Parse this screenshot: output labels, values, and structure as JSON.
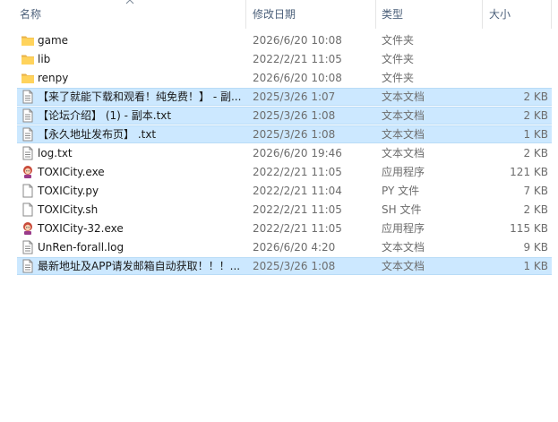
{
  "header": {
    "name": "名称",
    "date": "修改日期",
    "type": "类型",
    "size": "大小"
  },
  "rows": [
    {
      "name": "game",
      "date": "2026/6/20 10:08",
      "type": "文件夹",
      "size": "",
      "icon": "folder-icon",
      "selected": false
    },
    {
      "name": "lib",
      "date": "2022/2/21 11:05",
      "type": "文件夹",
      "size": "",
      "icon": "folder-icon",
      "selected": false
    },
    {
      "name": "renpy",
      "date": "2026/6/20 10:08",
      "type": "文件夹",
      "size": "",
      "icon": "folder-icon",
      "selected": false
    },
    {
      "name": "【来了就能下载和观看！纯免费！】 - 副...",
      "date": "2025/3/26 1:07",
      "type": "文本文档",
      "size": "2 KB",
      "icon": "text-file-icon",
      "selected": true
    },
    {
      "name": "【论坛介绍】 (1) - 副本.txt",
      "date": "2025/3/26 1:08",
      "type": "文本文档",
      "size": "2 KB",
      "icon": "text-file-icon",
      "selected": true
    },
    {
      "name": "【永久地址发布页】 .txt",
      "date": "2025/3/26 1:08",
      "type": "文本文档",
      "size": "1 KB",
      "icon": "text-file-icon",
      "selected": true
    },
    {
      "name": "log.txt",
      "date": "2026/6/20 19:46",
      "type": "文本文档",
      "size": "2 KB",
      "icon": "text-file-icon",
      "selected": false
    },
    {
      "name": "TOXICity.exe",
      "date": "2022/2/21 11:05",
      "type": "应用程序",
      "size": "121 KB",
      "icon": "renpy-app-icon",
      "selected": false
    },
    {
      "name": "TOXICity.py",
      "date": "2022/2/21 11:04",
      "type": "PY 文件",
      "size": "7 KB",
      "icon": "file-icon",
      "selected": false
    },
    {
      "name": "TOXICity.sh",
      "date": "2022/2/21 11:05",
      "type": "SH 文件",
      "size": "2 KB",
      "icon": "file-icon",
      "selected": false
    },
    {
      "name": "TOXICity-32.exe",
      "date": "2022/2/21 11:05",
      "type": "应用程序",
      "size": "115 KB",
      "icon": "renpy-app-icon",
      "selected": false
    },
    {
      "name": "UnRen-forall.log",
      "date": "2026/6/20 4:20",
      "type": "文本文档",
      "size": "9 KB",
      "icon": "text-file-icon",
      "selected": false
    },
    {
      "name": "最新地址及APP请发邮箱自动获取！！！...",
      "date": "2025/3/26 1:08",
      "type": "文本文档",
      "size": "1 KB",
      "icon": "text-file-icon",
      "selected": true
    }
  ]
}
